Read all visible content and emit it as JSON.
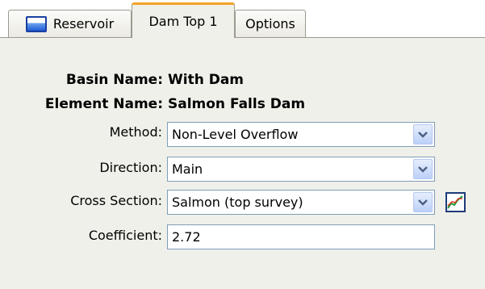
{
  "tabs": [
    {
      "label": "Reservoir",
      "icon": "reservoir-icon",
      "selected": false
    },
    {
      "label": "Dam Top 1",
      "selected": true
    },
    {
      "label": "Options",
      "selected": false
    }
  ],
  "info": {
    "basin_label": "Basin Name:",
    "basin_value": "With Dam",
    "element_label": "Element Name:",
    "element_value": "Salmon Falls Dam"
  },
  "fields": {
    "method": {
      "label": "Method:",
      "value": "Non-Level Overflow"
    },
    "direction": {
      "label": "Direction:",
      "value": "Main"
    },
    "cross_section": {
      "label": "Cross Section:",
      "value": "Salmon (top survey)",
      "button_icon": "cross-section-graph-icon"
    },
    "coefficient": {
      "label": "Coefficient:",
      "value": "2.72"
    }
  },
  "colors": {
    "panel_bg": "#f0f0ea",
    "active_tab_accent": "#f2a329",
    "combo_button": "#bcd0f7",
    "field_border": "#7f9db9"
  }
}
